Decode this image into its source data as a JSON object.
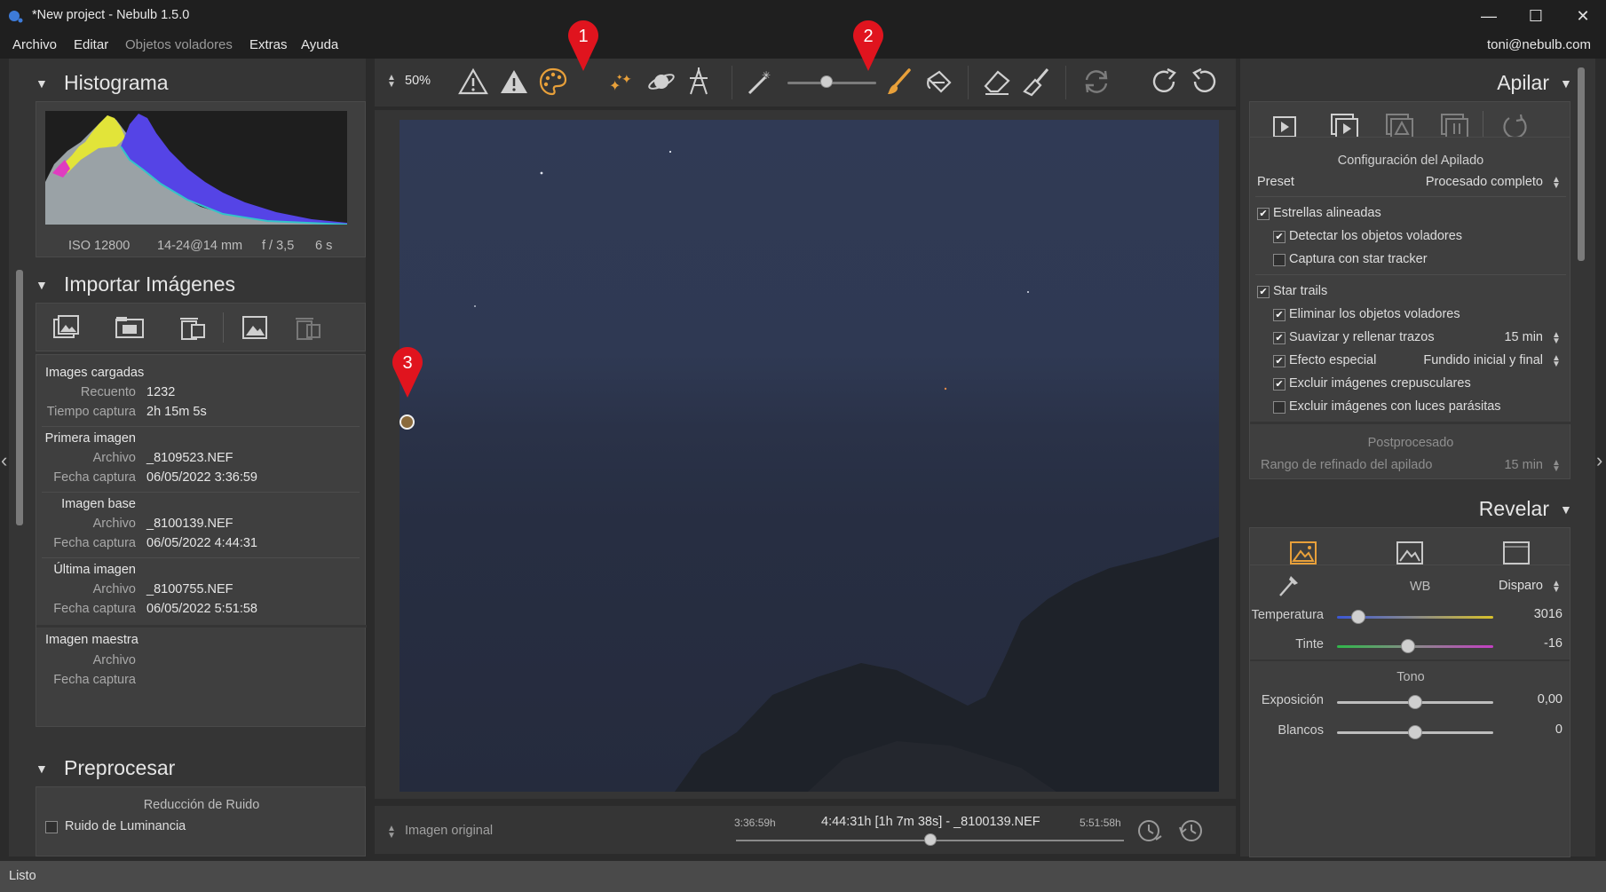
{
  "window": {
    "title": "*New project - Nebulb 1.5.0",
    "minimize_glyph": "—",
    "maximize_glyph": "☐",
    "close_glyph": "✕"
  },
  "menu": {
    "items": [
      "Archivo",
      "Editar",
      "Objetos voladores",
      "Extras",
      "Ayuda"
    ],
    "user": "toni@nebulb.com"
  },
  "toolbar": {
    "zoom": "50%",
    "icons": [
      "warning-outline-icon",
      "warning-filled-icon",
      "palette-icon",
      "stars-icon",
      "planet-icon",
      "tower-icon",
      "magic-wand-icon",
      "brush-size-slider",
      "brush-icon",
      "paint-bucket-icon",
      "eraser-icon",
      "broom-icon",
      "refresh-icon",
      "redo-icon",
      "undo-icon"
    ]
  },
  "markers": [
    "1",
    "2",
    "3"
  ],
  "histogram": {
    "title": "Histograma",
    "iso": "ISO 12800",
    "lens": "14-24@14 mm",
    "aperture": "f / 3,5",
    "exposure": "6 s"
  },
  "import": {
    "title": "Importar Imágenes",
    "loaded": {
      "heading": "Images cargadas",
      "count_label": "Recuento",
      "count": "1232",
      "time_label": "Tiempo captura",
      "time": "2h 15m 5s"
    },
    "first": {
      "heading": "Primera imagen",
      "file_label": "Archivo",
      "file": "_8109523.NEF",
      "date_label": "Fecha captura",
      "date": "06/05/2022 3:36:59"
    },
    "base": {
      "heading": "Imagen base",
      "file_label": "Archivo",
      "file": "_8100139.NEF",
      "date_label": "Fecha captura",
      "date": "06/05/2022 4:44:31"
    },
    "last": {
      "heading": "Última imagen",
      "file_label": "Archivo",
      "file": "_8100755.NEF",
      "date_label": "Fecha captura",
      "date": "06/05/2022 5:51:58"
    },
    "master": {
      "heading": "Imagen maestra",
      "file_label": "Archivo",
      "date_label": "Fecha captura"
    }
  },
  "preprocess": {
    "title": "Preprocesar",
    "noise_heading": "Reducción de Ruido",
    "luminance": "Ruido de Luminancia"
  },
  "bottom": {
    "view": "Imagen original",
    "start_time": "3:36:59h",
    "current": "4:44:31h [1h 7m 38s] - _8100139.NEF",
    "end_time": "5:51:58h",
    "timeline_position": 0.5
  },
  "stack": {
    "title": "Apilar",
    "config_heading": "Configuración del Apilado",
    "preset_label": "Preset",
    "preset_value": "Procesado completo",
    "aligned": "Estrellas alineadas",
    "detect": "Detectar los objetos voladores",
    "tracker": "Captura con star tracker",
    "trails": "Star trails",
    "remove": "Eliminar los objetos voladores",
    "smooth": "Suavizar y rellenar trazos",
    "smooth_value": "15 min",
    "effect": "Efecto especial",
    "effect_value": "Fundido inicial y final",
    "twilight": "Excluir imágenes crepusculares",
    "parasite": "Excluir imágenes con luces parásitas",
    "post_heading": "Postprocesado",
    "refine_label": "Rango de refinado del apilado",
    "refine_value": "15 min"
  },
  "reveal": {
    "title": "Revelar",
    "wb_label": "WB",
    "wb_value": "Disparo",
    "temp_label": "Temperatura",
    "temp_value": "3016",
    "tint_label": "Tinte",
    "tint_value": "-16",
    "tone_heading": "Tono",
    "exposure_label": "Exposición",
    "exposure_value": "0,00",
    "whites_label": "Blancos",
    "whites_value": "0"
  },
  "status": {
    "text": "Listo"
  },
  "colors": {
    "accent": "#e8a03a",
    "marker": "#e0141e",
    "background": "#2b2b2b",
    "panel": "#353535"
  }
}
